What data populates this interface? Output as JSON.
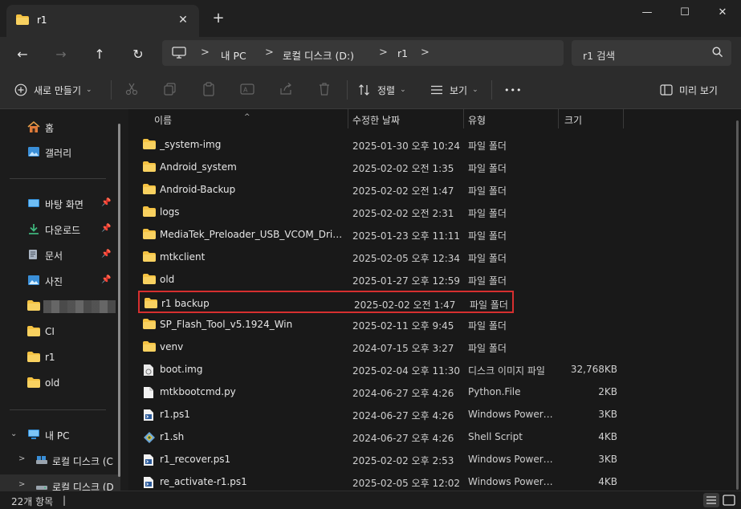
{
  "window": {
    "tab_title": "r1",
    "tab_close": "✕",
    "new_tab": "+",
    "minimize": "—",
    "maximize": "☐",
    "close": "✕"
  },
  "nav": {
    "back": "←",
    "forward": "→",
    "up": "↑",
    "refresh": "↻",
    "breadcrumb": [
      "내 PC",
      "로컬 디스크 (D:)",
      "r1"
    ],
    "search_placeholder": "r1 검색"
  },
  "commands": {
    "new_label": "새로 만들기",
    "sort_label": "정렬",
    "view_label": "보기",
    "more": "•••",
    "preview_label": "미리 보기"
  },
  "sidebar": {
    "items": [
      {
        "label": "홈",
        "icon": "home-icon"
      },
      {
        "label": "갤러리",
        "icon": "gallery-icon"
      },
      {
        "label": "바탕 화면",
        "icon": "desktop-icon",
        "pinned": true
      },
      {
        "label": "다운로드",
        "icon": "download-icon",
        "pinned": true
      },
      {
        "label": "문서",
        "icon": "document-icon",
        "pinned": true
      },
      {
        "label": "사진",
        "icon": "pictures-icon",
        "pinned": true
      },
      {
        "label": "",
        "icon": "folder-icon",
        "redacted": true
      },
      {
        "label": "CI",
        "icon": "folder-icon"
      },
      {
        "label": "r1",
        "icon": "folder-icon"
      },
      {
        "label": "old",
        "icon": "folder-icon"
      },
      {
        "label": "내 PC",
        "icon": "pc-icon"
      },
      {
        "label": "로컬 디스크 (C",
        "icon": "drive-icon"
      },
      {
        "label": "로컬 디스크 (D",
        "icon": "drive-icon"
      }
    ]
  },
  "columns": {
    "name": "이름",
    "date": "수정한 날짜",
    "type": "유형",
    "size": "크기"
  },
  "files": [
    {
      "name": "_system-img",
      "date": "2025-01-30 오후 10:24",
      "type": "파일 폴더",
      "size": "",
      "icon": "folder-icon"
    },
    {
      "name": "Android_system",
      "date": "2025-02-02 오전 1:35",
      "type": "파일 폴더",
      "size": "",
      "icon": "folder-icon"
    },
    {
      "name": "Android-Backup",
      "date": "2025-02-02 오전 1:47",
      "type": "파일 폴더",
      "size": "",
      "icon": "folder-icon"
    },
    {
      "name": "logs",
      "date": "2025-02-02 오전 2:31",
      "type": "파일 폴더",
      "size": "",
      "icon": "folder-icon"
    },
    {
      "name": "MediaTek_Preloader_USB_VCOM_Drivers...",
      "date": "2025-01-23 오후 11:11",
      "type": "파일 폴더",
      "size": "",
      "icon": "folder-icon"
    },
    {
      "name": "mtkclient",
      "date": "2025-02-05 오후 12:34",
      "type": "파일 폴더",
      "size": "",
      "icon": "folder-icon"
    },
    {
      "name": "old",
      "date": "2025-01-27 오후 12:59",
      "type": "파일 폴더",
      "size": "",
      "icon": "folder-icon"
    },
    {
      "name": "r1 backup",
      "date": "2025-02-02 오전 1:47",
      "type": "파일 폴더",
      "size": "",
      "icon": "folder-icon",
      "highlighted": true
    },
    {
      "name": "SP_Flash_Tool_v5.1924_Win",
      "date": "2025-02-11 오후 9:45",
      "type": "파일 폴더",
      "size": "",
      "icon": "folder-icon"
    },
    {
      "name": "venv",
      "date": "2024-07-15 오후 3:27",
      "type": "파일 폴더",
      "size": "",
      "icon": "folder-icon"
    },
    {
      "name": "boot.img",
      "date": "2025-02-04 오후 11:30",
      "type": "디스크 이미지 파일",
      "size": "32,768KB",
      "icon": "disk-image-icon"
    },
    {
      "name": "mtkbootcmd.py",
      "date": "2024-06-27 오후 4:26",
      "type": "Python.File",
      "size": "2KB",
      "icon": "python-file-icon"
    },
    {
      "name": "r1.ps1",
      "date": "2024-06-27 오후 4:26",
      "type": "Windows PowerS...",
      "size": "3KB",
      "icon": "powershell-icon"
    },
    {
      "name": "r1.sh",
      "date": "2024-06-27 오후 4:26",
      "type": "Shell Script",
      "size": "4KB",
      "icon": "shell-script-icon"
    },
    {
      "name": "r1_recover.ps1",
      "date": "2025-02-02 오후 2:53",
      "type": "Windows PowerS...",
      "size": "3KB",
      "icon": "powershell-icon"
    },
    {
      "name": "re_activate-r1.ps1",
      "date": "2025-02-05 오후 12:02",
      "type": "Windows PowerS...",
      "size": "4KB",
      "icon": "powershell-icon"
    }
  ],
  "status": {
    "count": "22개 항목",
    "separator": "|"
  },
  "colors": {
    "folder": "#f4c242",
    "accent": "#4ca0e0",
    "highlight_border": "#d62f2f"
  }
}
